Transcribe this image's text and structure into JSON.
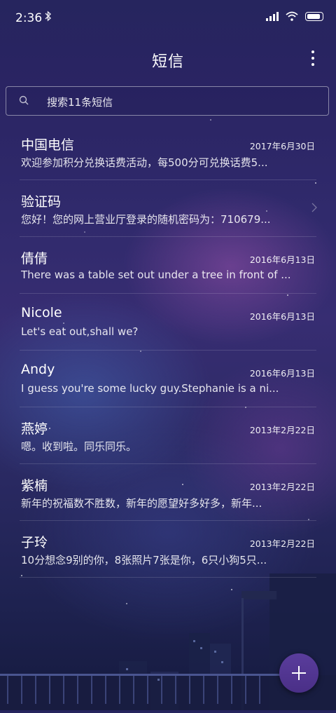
{
  "status_bar": {
    "time": "2:36",
    "bluetooth_icon": "bluetooth-icon",
    "signal_icon": "signal-icon",
    "wifi_icon": "wifi-icon",
    "battery_icon": "battery-icon"
  },
  "header": {
    "title": "短信",
    "more_icon": "more-vertical-icon"
  },
  "search": {
    "placeholder": "搜索11条短信",
    "icon": "search-icon"
  },
  "conversations": [
    {
      "name": "中国电信",
      "date": "2017年6月30日",
      "preview": "欢迎参加积分兑换话费活动，每500分可兑换话费5..."
    },
    {
      "name": "验证码",
      "date": "",
      "preview": "您好！您的网上营业厅登录的随机密码为：710679..."
    },
    {
      "name": "倩倩",
      "date": "2016年6月13日",
      "preview": "There was a table set out under a tree in front of ..."
    },
    {
      "name": "Nicole",
      "date": "2016年6月13日",
      "preview": "Let's eat out,shall we?"
    },
    {
      "name": "Andy",
      "date": "2016年6月13日",
      "preview": "I guess you're some lucky guy.Stephanie is a ni..."
    },
    {
      "name": "燕婷",
      "date": "2013年2月22日",
      "preview": "嗯。收到啦。同乐同乐。"
    },
    {
      "name": "紫楠",
      "date": "2013年2月22日",
      "preview": "新年的祝福数不胜数，新年的愿望好多好多，新年..."
    },
    {
      "name": "子玲",
      "date": "2013年2月22日",
      "preview": "10分想念9别的你，8张照片7张是你，6只小狗5只..."
    }
  ],
  "fab": {
    "icon": "plus-icon"
  },
  "colors": {
    "fab": "#4f3590",
    "background": "#2b2866"
  }
}
